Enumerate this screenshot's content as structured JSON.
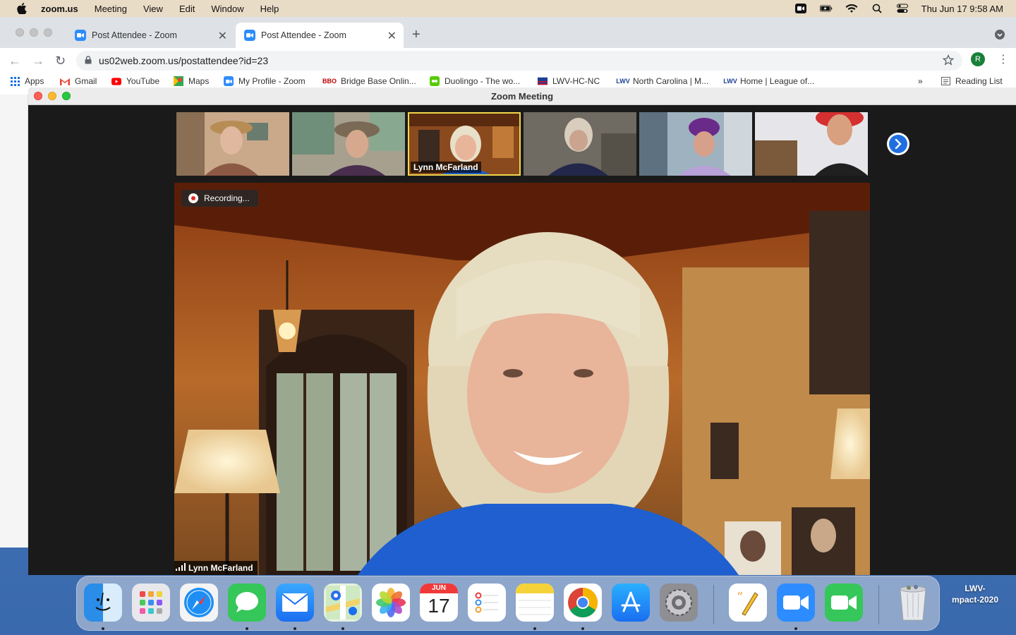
{
  "menubar": {
    "app_name": "zoom.us",
    "menus": [
      "Meeting",
      "View",
      "Edit",
      "Window",
      "Help"
    ],
    "clock": "Thu Jun 17  9:58 AM"
  },
  "browser": {
    "tabs": [
      {
        "title": "Post Attendee - Zoom"
      },
      {
        "title": "Post Attendee - Zoom"
      }
    ],
    "url": "us02web.zoom.us/postattendee?id=23",
    "profile_initial": "R",
    "bookmarks": [
      {
        "label": "Apps"
      },
      {
        "label": "Gmail"
      },
      {
        "label": "YouTube"
      },
      {
        "label": "Maps"
      },
      {
        "label": "My Profile - Zoom"
      },
      {
        "label": "Bridge Base Onlin..."
      },
      {
        "label": "Duolingo - The wo..."
      },
      {
        "label": "LWV-HC-NC"
      },
      {
        "label": "North Carolina | M..."
      },
      {
        "label": "Home | League of..."
      }
    ],
    "overflow": "»",
    "reading_list": "Reading List"
  },
  "zoom": {
    "window_title": "Zoom Meeting",
    "active_participant": "Lynn McFarland",
    "recording_label": "Recording...",
    "speaker_name": "Lynn McFarland"
  },
  "dock": {
    "calendar_month": "JUN",
    "calendar_day": "17",
    "desktop_item": "LWV-\nmpact-2020"
  },
  "colors": {
    "zoom_blue": "#2d8cff",
    "active_thumb_border": "#f0d64a",
    "recording_red": "#e02828"
  }
}
